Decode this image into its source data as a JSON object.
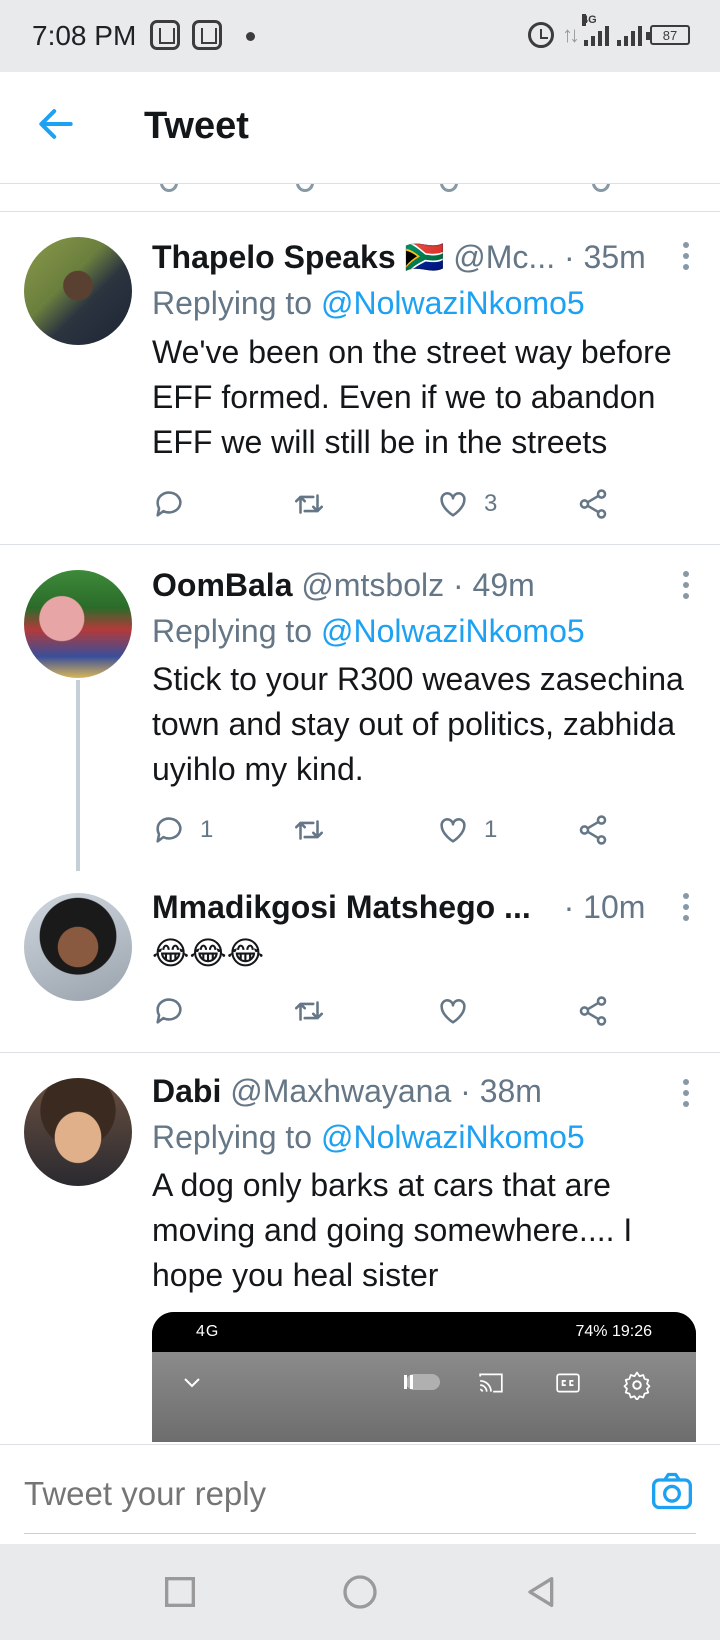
{
  "status_bar": {
    "time": "7:08 PM",
    "network": "4G",
    "battery": "87",
    "icons": [
      "app-notification-icon",
      "app-notification-icon",
      "alarm-icon",
      "data-arrows-icon",
      "signal-icon",
      "signal-icon",
      "battery-icon"
    ]
  },
  "header": {
    "title": "Tweet",
    "back_icon": "back-arrow-icon"
  },
  "tweets": [
    {
      "name": "Thapelo Speaks",
      "flag": "🇿🇦",
      "meta": "@Mc... · 35m",
      "replying_label": "Replying to ",
      "replying_handle": "@NolwaziNkomo5",
      "text": "We've been on the street way before EFF formed. Even if we to abandon EFF we will still be in the streets",
      "reply_count": "",
      "retweet_count": "",
      "like_count": "3"
    },
    {
      "name": "OomBala",
      "meta": "@mtsbolz · 49m",
      "replying_label": "Replying to ",
      "replying_handle": "@NolwaziNkomo5",
      "text": "Stick to your R300 weaves zasechina town and stay out of politics, zabhida uyihlo my kind.",
      "reply_count": "1",
      "retweet_count": "",
      "like_count": "1"
    },
    {
      "name": "Mmadikgosi Matshego ...",
      "meta": "· 10m",
      "text": "😂😂😂",
      "reply_count": "",
      "retweet_count": "",
      "like_count": ""
    },
    {
      "name": "Dabi",
      "meta": "@Maxhwayana · 38m",
      "replying_label": "Replying to ",
      "replying_handle": "@NolwaziNkomo5",
      "text": "A dog only barks at cars that are moving and going somewhere.... I hope you heal sister",
      "media": {
        "status_left": "4G",
        "status_right": "74% 19:26"
      }
    }
  ],
  "composer": {
    "placeholder": "Tweet your reply",
    "camera_icon": "camera-icon"
  },
  "colors": {
    "accent": "#1da1f2",
    "secondary_text": "#657786",
    "divider": "#dcdfe3"
  }
}
